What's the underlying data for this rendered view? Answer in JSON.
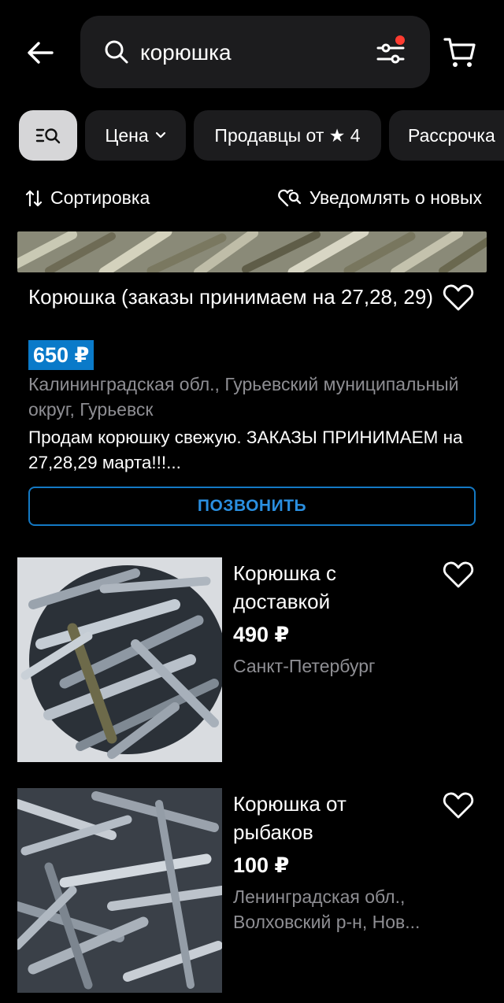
{
  "header": {
    "search_query": "корюшка",
    "icons": [
      "arrow-left-icon",
      "search-icon",
      "filter-sliders-icon",
      "cart-icon"
    ]
  },
  "filters": {
    "price_label": "Цена",
    "sellers_label": "Продавцы от ★ 4",
    "installment_label": "Рассрочка"
  },
  "sortbar": {
    "sort_label": "Сортировка",
    "notify_label": "Уведомлять о новых"
  },
  "listings": [
    {
      "title": "Корюшка (заказы принимаем на 27,28, 29)",
      "price": "650 ₽",
      "location": "Калининградская обл., Гурьевский муниципальный округ, Гурьевск",
      "description": "Продам корюшку свежую.  ЗАКАЗЫ ПРИНИМАЕМ на 27,28,29 марта!!!...",
      "call_label": "ПОЗВОНИТЬ"
    },
    {
      "title": "Корюшка с доставкой",
      "price": "490 ₽",
      "location": "Санкт-Петербург"
    },
    {
      "title": "Корюшка от рыбаков",
      "price": "100 ₽",
      "location": "Ленинградская обл., Волховский р-н, Нов..."
    }
  ],
  "colors": {
    "background": "#000000",
    "surface": "#1c1c1e",
    "accent_blue": "#0a7ac9",
    "notification_dot": "#ff3b30",
    "secondary_text": "#8e8e93"
  }
}
